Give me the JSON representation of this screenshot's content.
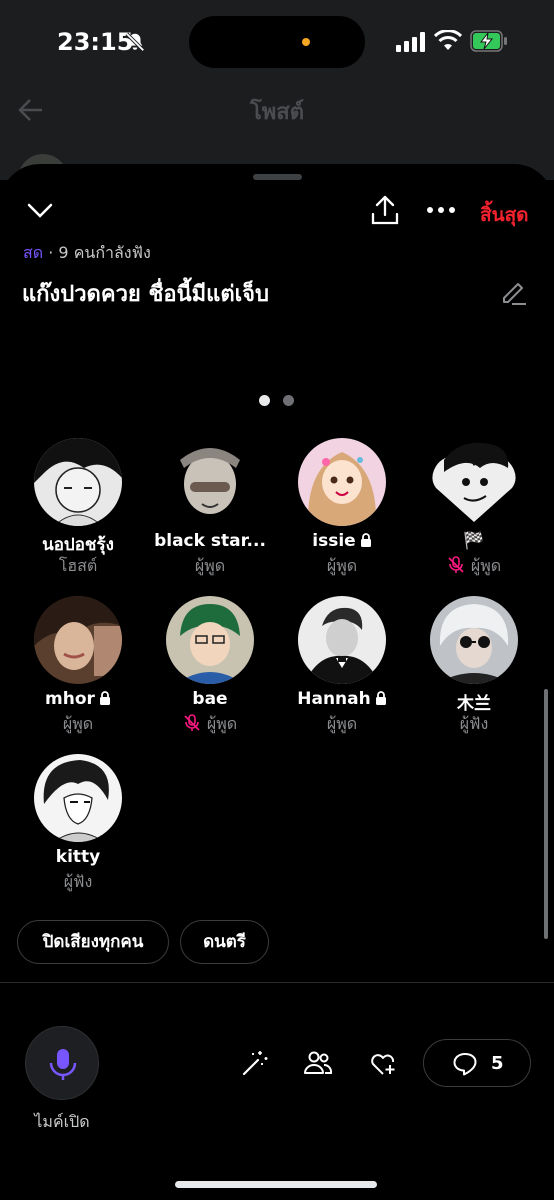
{
  "status_bar": {
    "time": "23:15"
  },
  "background": {
    "title": "โพสต์"
  },
  "header": {
    "end_label": "สิ้นสุด"
  },
  "space": {
    "live_label": "สด",
    "listening": "· 9 คนกำลังฟัง",
    "title": "แก๊งปวดควย ชื่อนี้มีแต่เจ็บ"
  },
  "participants": [
    {
      "name": "นอปอชรุ้ง",
      "role": "โฮสต์",
      "locked": false,
      "muted": false
    },
    {
      "name": "black star...",
      "role": "ผู้พูด",
      "locked": false,
      "muted": false
    },
    {
      "name": "issie",
      "role": "ผู้พูด",
      "locked": true,
      "muted": false
    },
    {
      "name": "🏁",
      "role": "ผู้พูด",
      "locked": false,
      "muted": true
    },
    {
      "name": "mhor",
      "role": "ผู้พูด",
      "locked": true,
      "muted": false
    },
    {
      "name": "bae",
      "role": "ผู้พูด",
      "locked": false,
      "muted": true
    },
    {
      "name": "Hannah",
      "role": "ผู้พูด",
      "locked": true,
      "muted": false
    },
    {
      "name": "木兰",
      "role": "ผู้ฟัง",
      "locked": false,
      "muted": false
    },
    {
      "name": "kitty",
      "role": "ผู้ฟัง",
      "locked": false,
      "muted": false
    }
  ],
  "chips": {
    "mute_all": "ปิดเสียงทุกคน",
    "music": "ดนตรี"
  },
  "bottom": {
    "mic_label": "ไมค์เปิด",
    "comment_count": "5"
  },
  "colors": {
    "accent": "#7856ff",
    "danger": "#f4212e",
    "muted_icon": "#f91880"
  }
}
